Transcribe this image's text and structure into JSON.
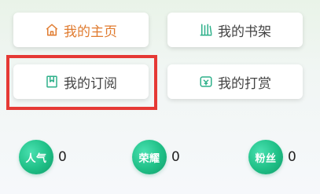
{
  "menu": {
    "home": {
      "label": "我的主页",
      "icon": "house-icon",
      "color": "#e07b2f"
    },
    "shelf": {
      "label": "我的书架",
      "icon": "bookshelf-icon",
      "color": "#2eb08a"
    },
    "subscribe": {
      "label": "我的订阅",
      "icon": "bookmark-icon",
      "color": "#2eb08a"
    },
    "reward": {
      "label": "我的打赏",
      "icon": "reward-icon",
      "color": "#2eb08a"
    }
  },
  "stats": [
    {
      "badge": "人气",
      "value": "0"
    },
    {
      "badge": "荣耀",
      "value": "0"
    },
    {
      "badge": "粉丝",
      "value": "0"
    }
  ],
  "colors": {
    "accent_green": "#1fbf86",
    "highlight_red": "#e53935"
  }
}
